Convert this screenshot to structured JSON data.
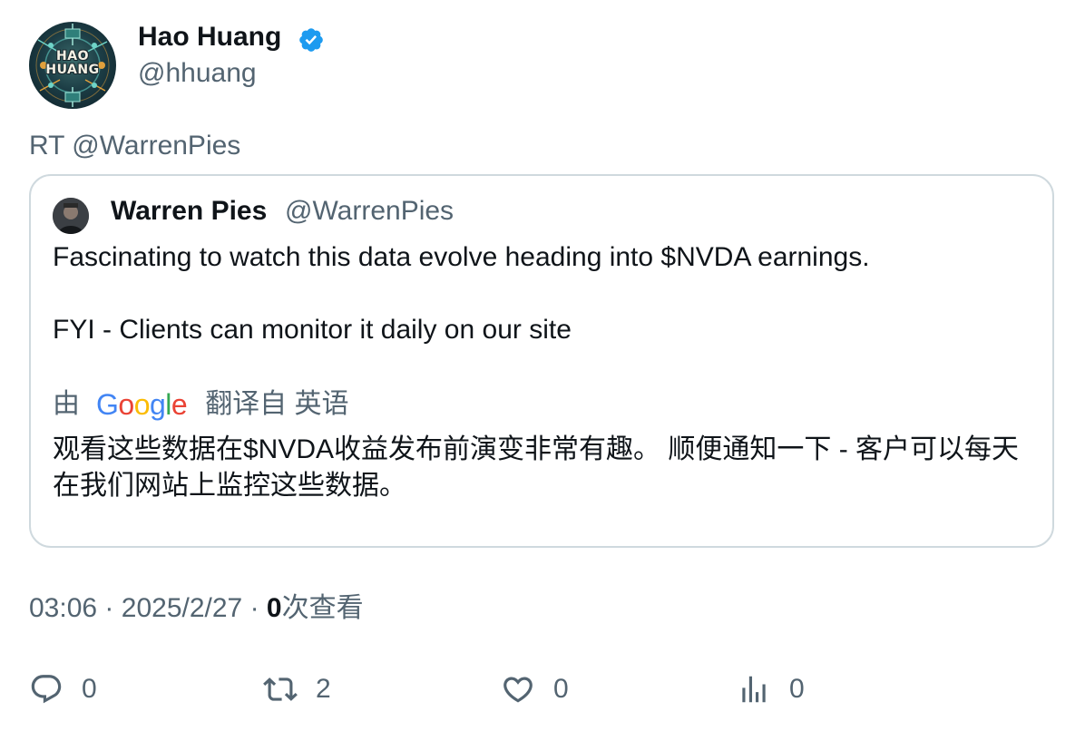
{
  "author": {
    "name": "Hao Huang",
    "handle": "@hhuang",
    "avatar_text_line1": "HAO",
    "avatar_text_line2": "HUANG",
    "verified_icon": "verified-badge-icon",
    "verified_color": "#1d9bf0"
  },
  "retweet": {
    "label": "RT @WarrenPies"
  },
  "quote": {
    "name": "Warren Pies",
    "handle": "@WarrenPies",
    "line1": "Fascinating to watch this data evolve heading into $NVDA earnings.",
    "line2": "FYI - Clients can monitor it daily on our site",
    "translate_prefix": "由",
    "translate_suffix": "翻译自 英语",
    "google_logo": "Google",
    "translated_text": "观看这些数据在$NVDA收益发布前演变非常有趣。 顺便通知一下 - 客户可以每天在我们网站上监控这些数据。"
  },
  "meta": {
    "time": "03:06",
    "separator": "·",
    "date": "2025/2/27",
    "views_count": "0",
    "views_label": "次查看"
  },
  "actions": {
    "reply_count": "0",
    "retweet_count": "2",
    "like_count": "0",
    "views_count": "0"
  },
  "colors": {
    "text_primary": "#0f1419",
    "text_secondary": "#536471",
    "border": "#cfd9de",
    "google_blue": "#4285f4",
    "google_red": "#ea4335",
    "google_yellow": "#fbbc05",
    "google_green": "#34a853"
  }
}
